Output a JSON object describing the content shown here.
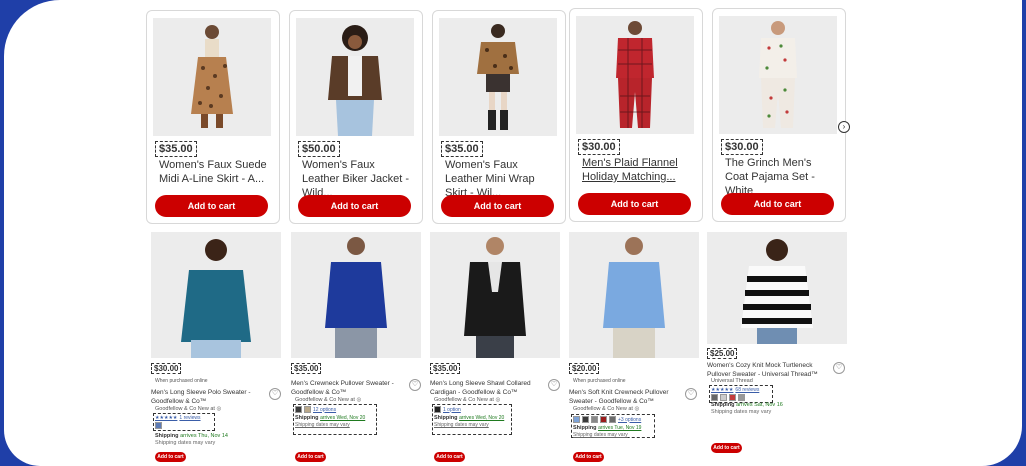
{
  "top_cards": [
    {
      "price": "$35.00",
      "title": "Women's Faux Suede Midi A-Line Skirt - A...",
      "link": false,
      "button": "Add to cart",
      "outfit": "leopard-skirt"
    },
    {
      "price": "$50.00",
      "title": "Women's Faux Leather Biker Jacket - Wild...",
      "link": false,
      "button": "Add to cart",
      "outfit": "leather-jacket"
    },
    {
      "price": "$35.00",
      "title": "Women's Faux Leather Mini Wrap Skirt - Wil...",
      "link": false,
      "button": "Add to cart",
      "outfit": "leopard-jacket"
    },
    {
      "price": "$30.00",
      "title": "Men's Plaid Flannel Holiday Matching...",
      "link": true,
      "button": "Add to cart",
      "outfit": "red-plaid-pajama"
    },
    {
      "price": "$30.00",
      "title": "The Grinch Men's Coat Pajama Set - White",
      "link": false,
      "button": "Add to cart",
      "outfit": "white-pajama"
    }
  ],
  "bottom_cards": [
    {
      "price": "$30.00",
      "note": "When purchased online",
      "name": "Men's Long Sleeve Polo Sweater - Goodfellow & Co™",
      "brand": "Goodfellow & Co  New at ◎",
      "stars": "★★★★★",
      "reviews": "1 reviews",
      "options": "",
      "ship_label": "Shipping",
      "ship_time": "arrives Thu, Nov 14",
      "ship_sub": "Shipping dates may vary",
      "button": "Add to cart",
      "swatches": [
        "#5d7bb5"
      ]
    },
    {
      "price": "$35.00",
      "note": "",
      "name": "Men's Crewneck Pullover Sweater - Goodfellow & Co™",
      "brand": "Goodfellow & Co  New at ◎",
      "stars": "",
      "reviews": "",
      "options": "12 options",
      "ship_label": "Shipping",
      "ship_time": "arrives Wed, Nov 20",
      "ship_sub": "Shipping dates may vary",
      "button": "Add to cart",
      "swatches": [
        "#3b3b3b",
        "#b9a88a"
      ]
    },
    {
      "price": "$35.00",
      "note": "",
      "name": "Men's Long Sleeve Shawl Collared Cardigan - Goodfellow & Co™",
      "brand": "Goodfellow & Co  New at ◎",
      "stars": "",
      "reviews": "",
      "options": "1 option",
      "ship_label": "Shipping",
      "ship_time": "arrives Wed, Nov 20",
      "ship_sub": "Shipping dates may vary",
      "button": "Add to cart",
      "swatches": [
        "#222222"
      ]
    },
    {
      "price": "$20.00",
      "note": "When purchased online",
      "name": "Men's Soft Knit Crewneck Pullover Sweater - Goodfellow & Co™",
      "brand": "Goodfellow & Co  New at ◎",
      "stars": "",
      "reviews": "",
      "options": "+3 options",
      "ship_label": "Shipping",
      "ship_time": "arrives Tue, Nov 19",
      "ship_sub": "Shipping dates may vary",
      "button": "Add to cart",
      "swatches": [
        "#7da3d8",
        "#3a3a3a",
        "#888888",
        "#9a1c1c",
        "#6b6b6b"
      ]
    },
    {
      "price": "$25.00",
      "note": "",
      "name": "Women's Cozy Knit Mock Turtleneck Pullover Sweater - Universal Thread™",
      "brand": "Universal Thread",
      "stars": "★★★★★",
      "reviews": "68 reviews",
      "options": "",
      "ship_label": "Shipping",
      "ship_time": "arrives Sat, Nov 16",
      "ship_sub": "Shipping dates may vary",
      "button": "Add to cart",
      "swatches": [
        "#666666",
        "#cccccc",
        "#c43c3c",
        "#999999"
      ]
    }
  ],
  "colors": {
    "accent": "#cc0000",
    "frame": "#1f3fa8",
    "ship_green": "#1f7a1f"
  },
  "icons": {
    "heart": "heart-icon",
    "scroll": "chevron-right-icon"
  }
}
